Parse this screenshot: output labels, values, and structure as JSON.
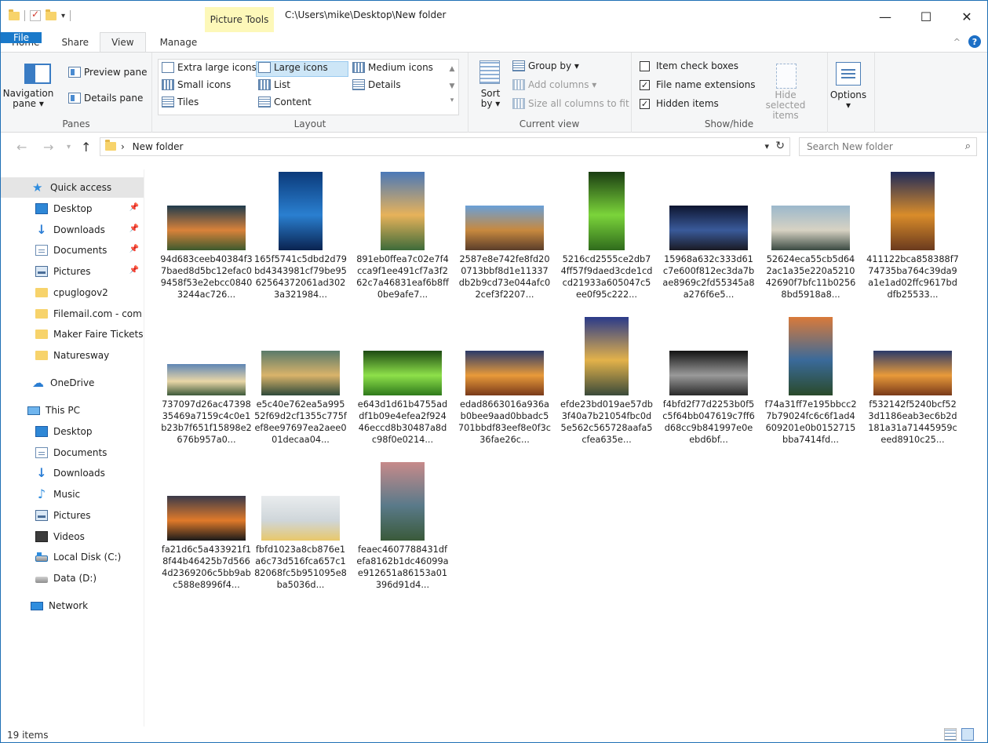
{
  "window": {
    "context_tab": "Picture Tools",
    "title_path": "C:\\Users\\mike\\Desktop\\New folder",
    "buttons": {
      "minimize": "—",
      "maximize": "☐",
      "close": "✕"
    }
  },
  "tabs": {
    "file": "File",
    "home": "Home",
    "share": "Share",
    "view": "View",
    "manage": "Manage"
  },
  "ribbon": {
    "panes": {
      "label": "Panes",
      "navigation_pane": "Navigation pane ▾",
      "preview_pane": "Preview pane",
      "details_pane": "Details pane"
    },
    "layout": {
      "label": "Layout",
      "extra_large_icons": "Extra large icons",
      "large_icons": "Large icons",
      "medium_icons": "Medium icons",
      "small_icons": "Small icons",
      "list": "List",
      "details": "Details",
      "tiles": "Tiles",
      "content": "Content",
      "selected": "Large icons"
    },
    "current_view": {
      "label": "Current view",
      "sort_by": "Sort by ▾",
      "group_by": "Group by ▾",
      "add_columns": "Add columns ▾",
      "size_all_columns": "Size all columns to fit"
    },
    "show_hide": {
      "label": "Show/hide",
      "item_check_boxes": "Item check boxes",
      "file_name_extensions": "File name extensions",
      "hidden_items": "Hidden items",
      "hide_selected_items": "Hide selected items",
      "item_check_boxes_checked": false,
      "file_name_extensions_checked": true,
      "hidden_items_checked": true
    },
    "options": {
      "label": "Options"
    }
  },
  "address": {
    "breadcrumb_sep": "›",
    "path": "New folder",
    "search_placeholder": "Search New folder"
  },
  "sidebar": {
    "quick_access": "Quick access",
    "quick_items": [
      {
        "label": "Desktop",
        "icon": "desktop-icon",
        "pinned": true
      },
      {
        "label": "Downloads",
        "icon": "downloads-icon",
        "pinned": true
      },
      {
        "label": "Documents",
        "icon": "documents-icon",
        "pinned": true
      },
      {
        "label": "Pictures",
        "icon": "pictures-icon",
        "pinned": true
      },
      {
        "label": "cpuglogov2",
        "icon": "folder-icon",
        "pinned": false
      },
      {
        "label": "Filemail.com - com",
        "icon": "folder-icon",
        "pinned": false
      },
      {
        "label": "Maker Faire Tickets",
        "icon": "folder-icon",
        "pinned": false
      },
      {
        "label": "Naturesway",
        "icon": "folder-icon",
        "pinned": false
      }
    ],
    "onedrive": "OneDrive",
    "this_pc": "This PC",
    "pc_items": [
      {
        "label": "Desktop",
        "icon": "desktop-icon"
      },
      {
        "label": "Documents",
        "icon": "documents-icon"
      },
      {
        "label": "Downloads",
        "icon": "downloads-icon"
      },
      {
        "label": "Music",
        "icon": "music-icon"
      },
      {
        "label": "Pictures",
        "icon": "pictures-icon"
      },
      {
        "label": "Videos",
        "icon": "videos-icon"
      },
      {
        "label": "Local Disk (C:)",
        "icon": "local-disk-icon"
      },
      {
        "label": "Data (D:)",
        "icon": "drive-icon"
      }
    ],
    "network": "Network"
  },
  "files": [
    {
      "name": "94d683ceeb40384f37baed8d5bc12efac09458f53e2ebcc08403244ac726...",
      "colors": [
        "#1f3b4d",
        "#d9823a",
        "#3c5a2e"
      ]
    },
    {
      "name": "165f5741c5dbd2d79bd4343981cf79be9562564372061ad3023a321984...",
      "colors": [
        "#0b3a7a",
        "#2a7fd0",
        "#0a2350"
      ]
    },
    {
      "name": "891eb0ffea7c02e7f4cca9f1ee491cf7a3f262c7a46831eaf6b8ff0be9afe7...",
      "colors": [
        "#4a78b8",
        "#e7b25a",
        "#3d6b3a"
      ]
    },
    {
      "name": "2587e8e742fe8fd200713bbf8d1e11337db2b9cd73e044afc02cef3f2207...",
      "colors": [
        "#6aa0d8",
        "#c8893f",
        "#5a3d2a"
      ]
    },
    {
      "name": "5216cd2555ce2db74ff57f9daed3cde1cdcd21933a605047c5ee0f95c222...",
      "colors": [
        "#1a3d12",
        "#7bd43a",
        "#2f6b1c"
      ]
    },
    {
      "name": "15968a632c333d61c7e600f812ec3da7bae8969c2fd55345a8a276f6e5...",
      "colors": [
        "#0d1530",
        "#3a5a9a",
        "#1a1a24"
      ]
    },
    {
      "name": "52624eca55cb5d642ac1a35e220a521042690f7bfc11b02568bd5918a8...",
      "colors": [
        "#9bb8cc",
        "#d7d2c3",
        "#3a4a42"
      ]
    },
    {
      "name": "411122bca858388f774735ba764c39da9a1e1ad02ffc9617bddfb25533...",
      "colors": [
        "#1e2a5a",
        "#d98c2a",
        "#6a3a1e"
      ]
    },
    {
      "name": "737097d26ac4739835469a7159c4c0e1b23b7f651f15898e2676b957a0...",
      "colors": [
        "#5f86b5",
        "#e9d6a7",
        "#3d5a3a"
      ]
    },
    {
      "name": "e5c40e762ea5a99552f69d2cf1355c775fef8ee97697ea2aee001decaa04...",
      "colors": [
        "#5a7a6a",
        "#d9b36a",
        "#2e4a3a"
      ]
    },
    {
      "name": "e643d1d61b4755addf1b09e4efea2f92446eccd8b30487a8dc98f0e0214...",
      "colors": [
        "#1d4a12",
        "#8ee04a",
        "#2f7a1c"
      ]
    },
    {
      "name": "edad8663016a936ab0bee9aad0bbadc5701bbdf83eef8e0f3c36fae26c...",
      "colors": [
        "#2a3a6a",
        "#e89a3a",
        "#7a3a1a"
      ]
    },
    {
      "name": "efde23bd019ae57db3f40a7b21054fbc0d5e562c565728aafa5cfea635e...",
      "colors": [
        "#2a3a8a",
        "#e3b24a",
        "#3a4a3a"
      ]
    },
    {
      "name": "f4bfd2f77d2253b0f5c5f64bb047619c7ff6d68cc9b841997e0eebd6bf...",
      "colors": [
        "#121212",
        "#9a9a9a",
        "#2a2a2a"
      ]
    },
    {
      "name": "f74a31ff7e195bbcc27b79024fc6c6f1ad4609201e0b0152715bba7414fd...",
      "colors": [
        "#d97a3a",
        "#3a6a9a",
        "#2a4a2a"
      ]
    },
    {
      "name": "f532142f5240bcf523d1186eab3ec6b2d181a31a71445959ceed8910c25...",
      "colors": [
        "#2a3a6a",
        "#e89a3a",
        "#7a3a1a"
      ]
    },
    {
      "name": "fa21d6c5a433921f18f44b46425b7d5664d2369206c5bb9abc588e8996f4...",
      "colors": [
        "#3a3a4a",
        "#e07a2a",
        "#1a1a1a"
      ]
    },
    {
      "name": "fbfd1023a8cb876e1a6c73d516fca657c182068fc5b951095e8ba5036d...",
      "colors": [
        "#e9ecee",
        "#cfd6da",
        "#e8c86a"
      ]
    },
    {
      "name": "feaec4607788431dfefa8162b1dc46099ae912651a86153a01396d91d4...",
      "colors": [
        "#c78a8a",
        "#5a7a8a",
        "#3a5a3a"
      ]
    }
  ],
  "status": {
    "item_count": "19 items"
  }
}
